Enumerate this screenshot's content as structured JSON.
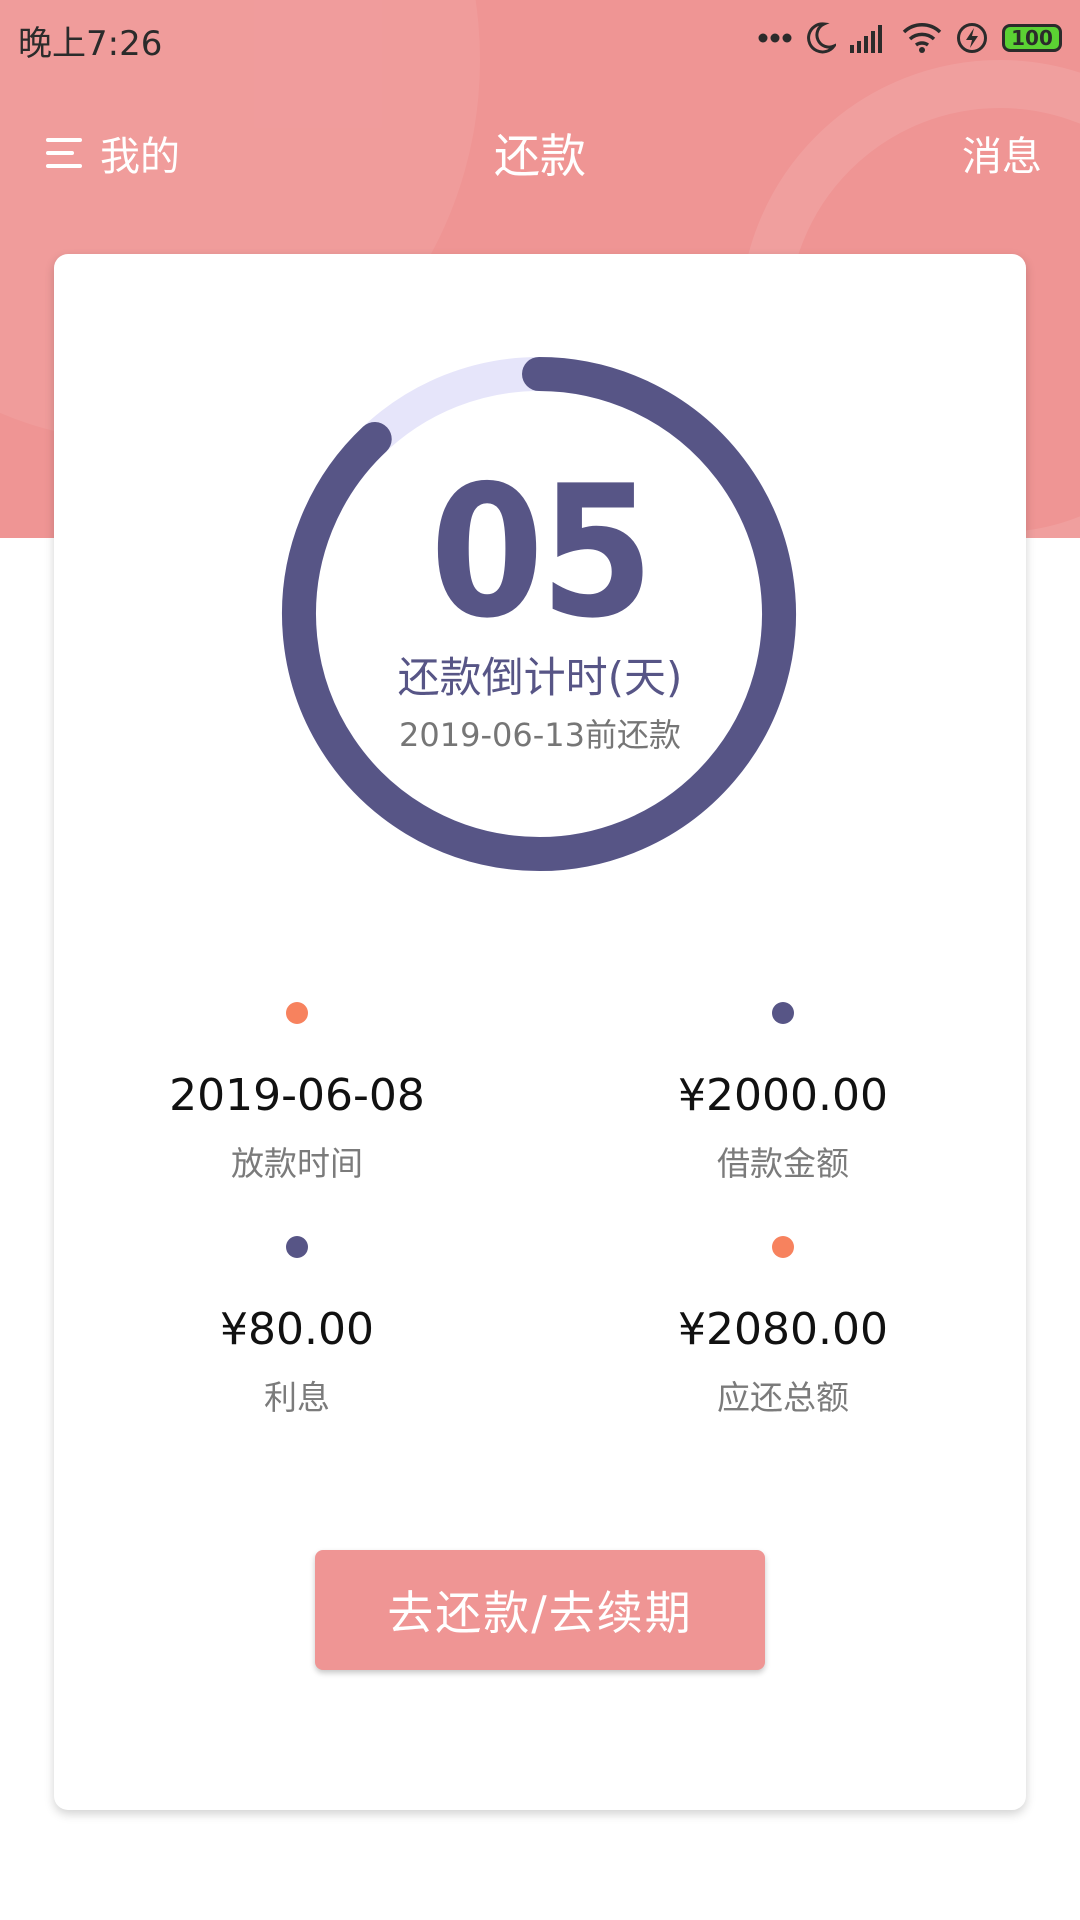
{
  "status_bar": {
    "time": "晚上7:26",
    "battery": "100"
  },
  "header": {
    "menu_label": "我的",
    "title": "还款",
    "messages_label": "消息"
  },
  "countdown": {
    "days": "05",
    "label": "还款倒计时(天)",
    "due_text": "2019-06-13前还款",
    "progress_fraction": 0.88
  },
  "stats": [
    {
      "value": "2019-06-08",
      "label": "放款时间",
      "dot_color": "#f7825e"
    },
    {
      "value": "¥2000.00",
      "label": "借款金额",
      "dot_color": "#575586"
    },
    {
      "value": "¥80.00",
      "label": "利息",
      "dot_color": "#575586"
    },
    {
      "value": "¥2080.00",
      "label": "应还总额",
      "dot_color": "#f7825e"
    }
  ],
  "action": {
    "label": "去还款/去续期"
  },
  "colors": {
    "brand": "#ef9594",
    "ring": "#575586",
    "ring_track": "#e6e5fa",
    "accent": "#f7825e"
  }
}
